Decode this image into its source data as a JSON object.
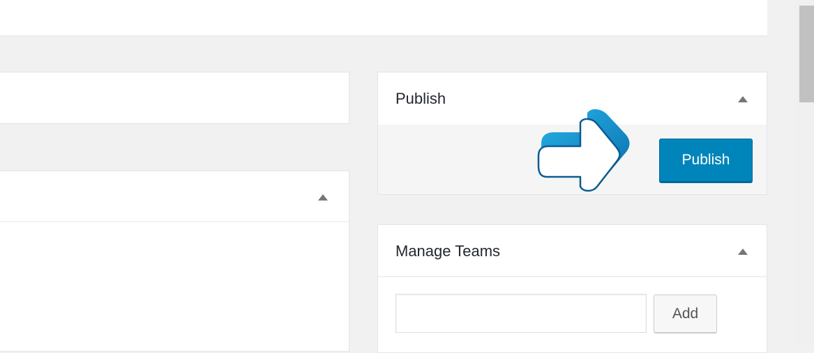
{
  "publish_box": {
    "title": "Publish",
    "publish_label": "Publish"
  },
  "manage_teams_box": {
    "title": "Manage Teams",
    "team_input_value": "",
    "add_label": "Add"
  },
  "colors": {
    "primary_button": "#0085ba",
    "annotation_arrow": "#1fa3d6"
  },
  "icons": {
    "collapse_toggle": "triangle-up-icon",
    "annotation": "right-arrow-icon"
  }
}
